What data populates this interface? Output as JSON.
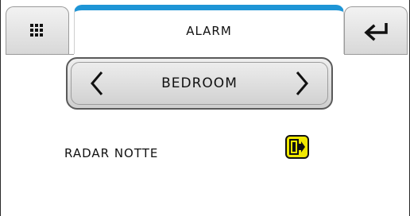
{
  "header": {
    "title": "ALARM",
    "menu_icon": "grid-icon",
    "back_icon": "return-arrow-icon",
    "accent_color": "#1e95d6"
  },
  "room_selector": {
    "current_room": "BEDROOM",
    "prev_icon": "chevron-left-icon",
    "next_icon": "chevron-right-icon"
  },
  "alarms": [
    {
      "name": "RADAR NOTTE",
      "icon": "door-exit-icon",
      "icon_color": "#f0e800"
    }
  ]
}
